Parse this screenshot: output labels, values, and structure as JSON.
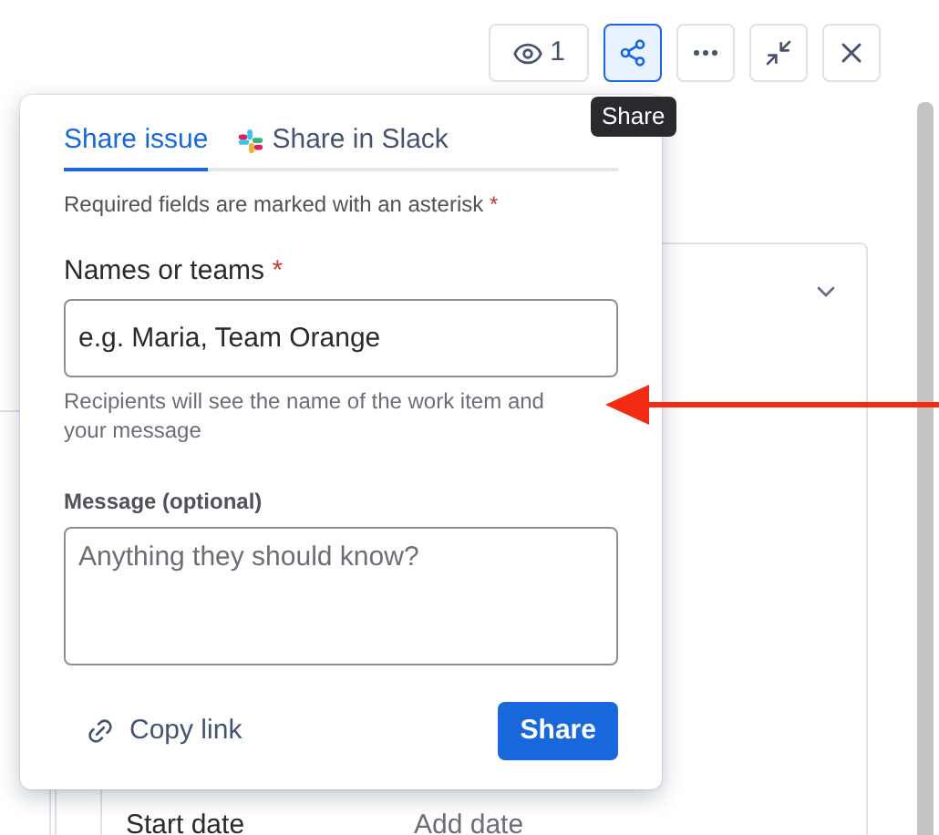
{
  "toolbar": {
    "watchers": "1",
    "tooltip": "Share"
  },
  "details": [
    {
      "label": "Start date",
      "value": "Add date"
    }
  ],
  "share_popover": {
    "tabs": [
      {
        "label": "Share issue",
        "selected": true,
        "kind": "plain"
      },
      {
        "label": "Share in Slack",
        "selected": false,
        "kind": "slack"
      }
    ],
    "required_note": "Required fields are marked with an asterisk",
    "asterisk": "*",
    "names_field": {
      "label": "Names or teams",
      "required": true,
      "placeholder": "e.g. Maria, Team Orange",
      "help": "Recipients will see the name of the work item and your message"
    },
    "message_field": {
      "label": "Message (optional)",
      "placeholder": "Anything they should know?"
    },
    "copy_link": "Copy link",
    "share_button": "Share"
  }
}
